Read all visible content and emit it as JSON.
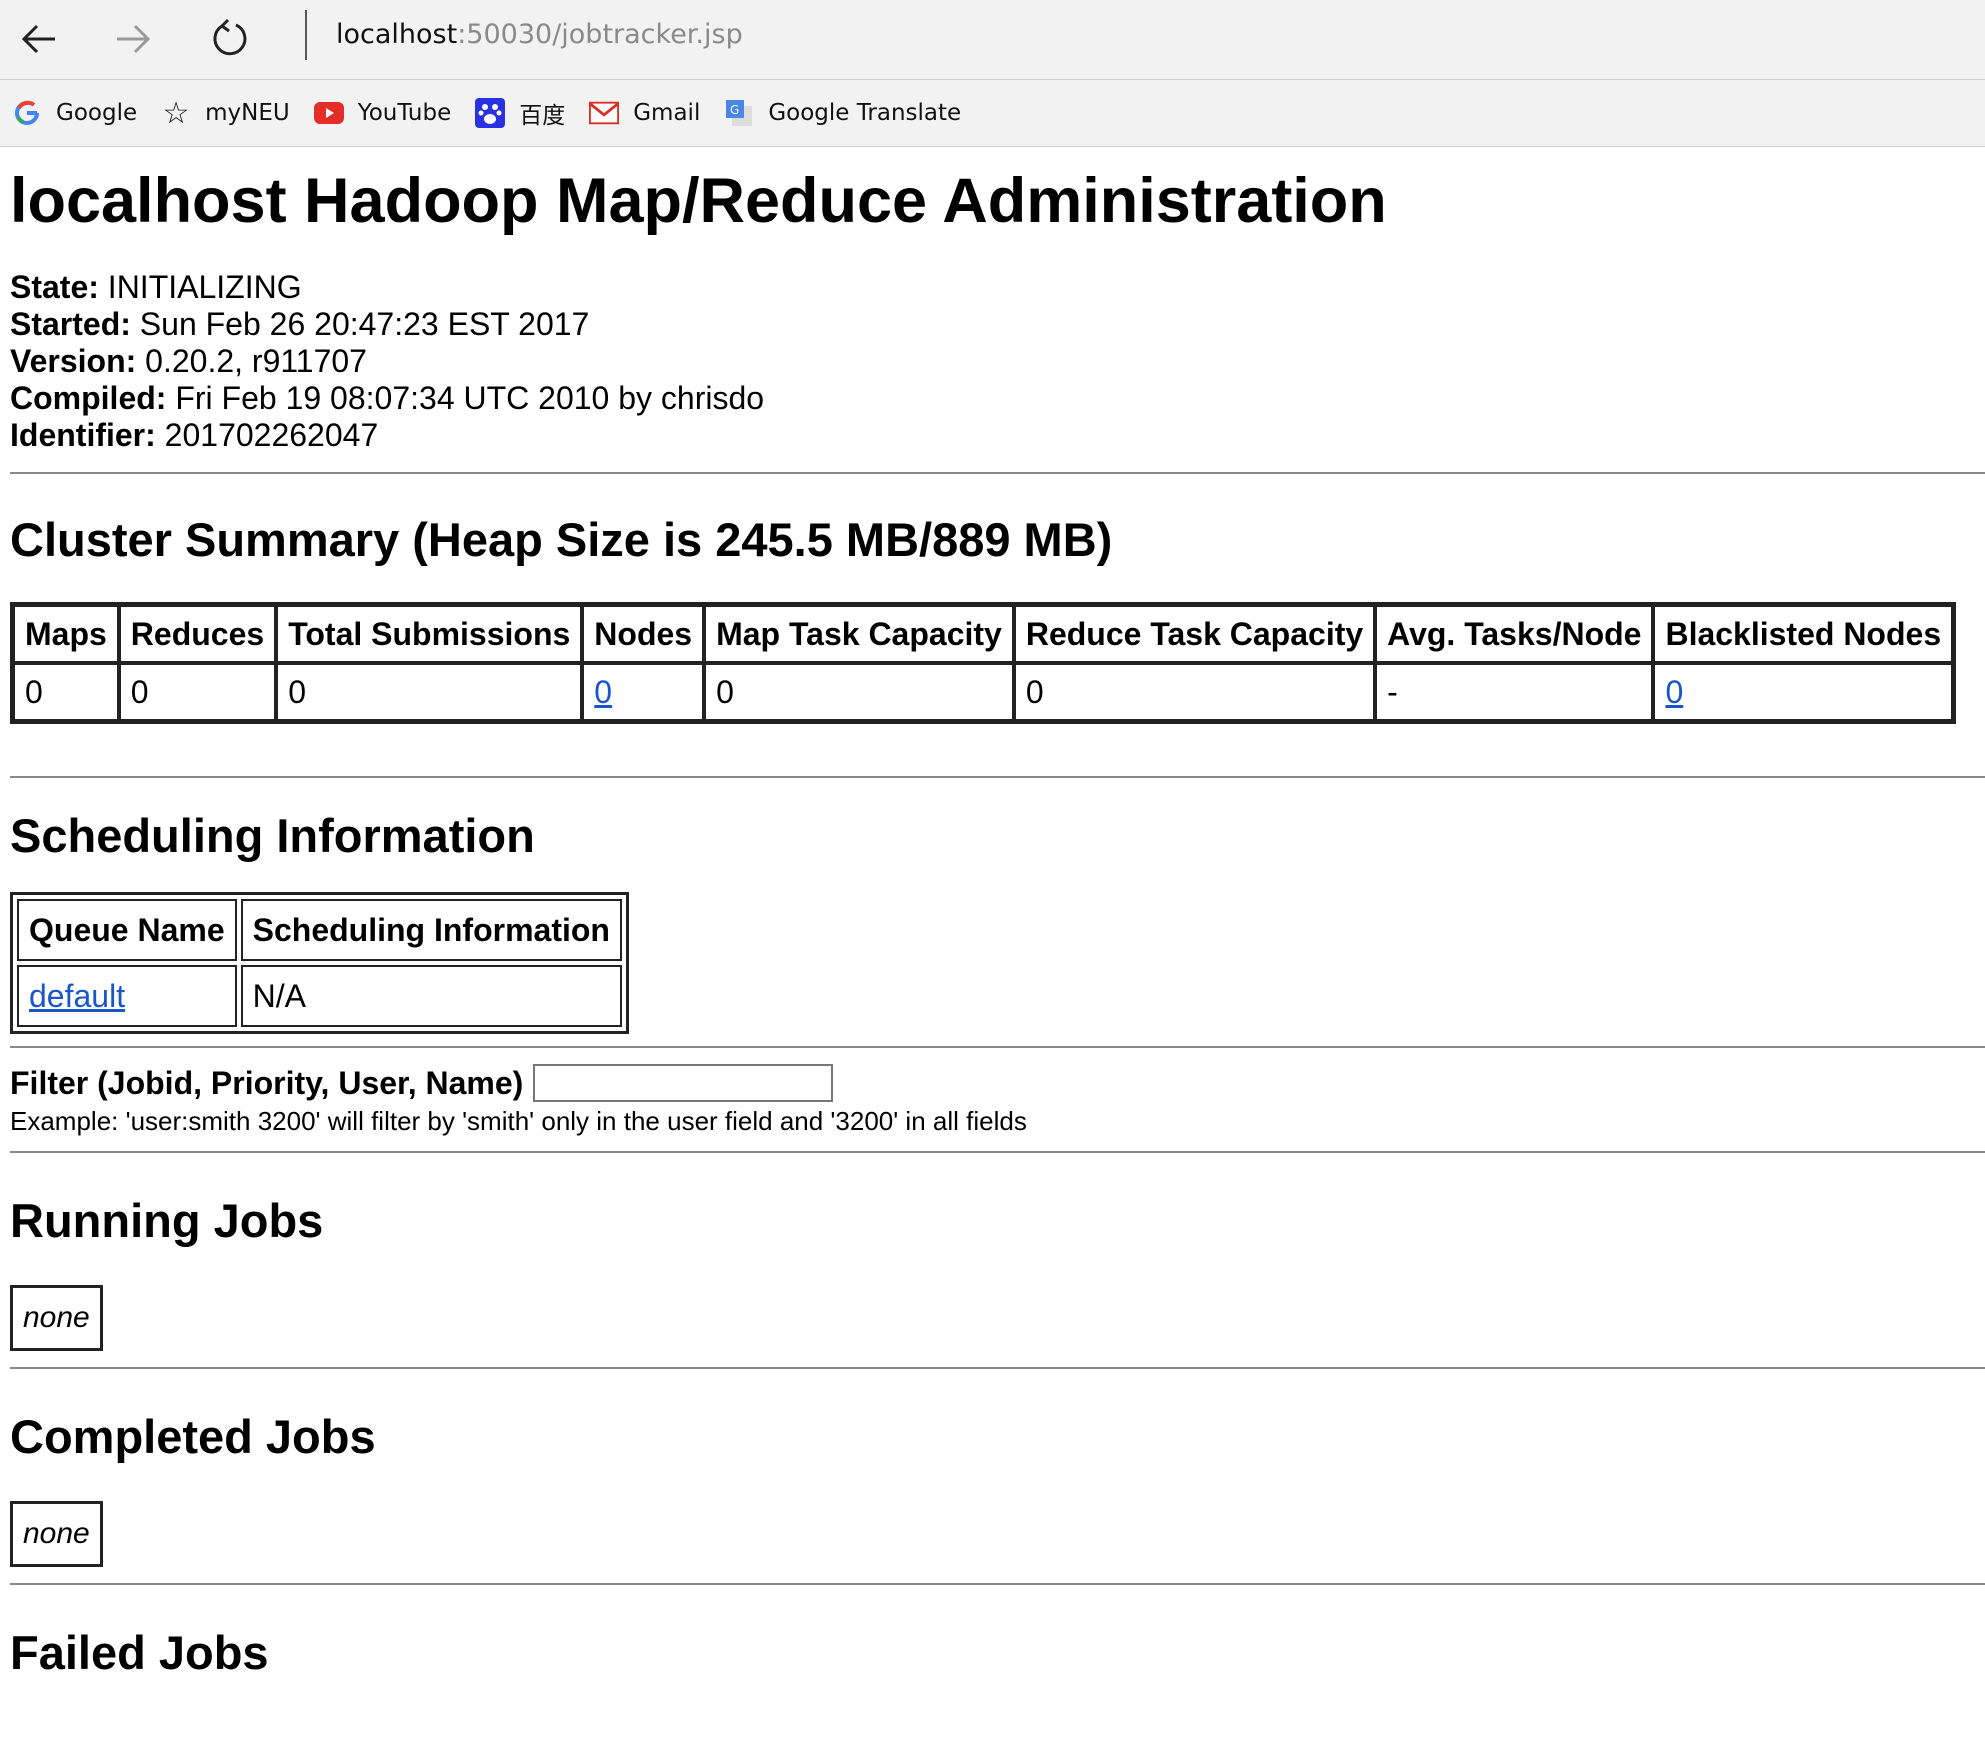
{
  "browser": {
    "address_host": "localhost",
    "address_path": ":50030/jobtracker.jsp",
    "favorites": [
      {
        "label": "Google",
        "icon": "google-icon"
      },
      {
        "label": "myNEU",
        "icon": "star-icon"
      },
      {
        "label": "YouTube",
        "icon": "youtube-icon"
      },
      {
        "label": "百度",
        "icon": "baidu-icon"
      },
      {
        "label": "Gmail",
        "icon": "gmail-icon"
      },
      {
        "label": "Google Translate",
        "icon": "google-translate-icon"
      }
    ]
  },
  "page": {
    "title": "localhost Hadoop Map/Reduce Administration",
    "info": [
      {
        "key": "State:",
        "value": " INITIALIZING"
      },
      {
        "key": "Started:",
        "value": " Sun Feb 26 20:47:23 EST 2017"
      },
      {
        "key": "Version:",
        "value": " 0.20.2, r911707"
      },
      {
        "key": "Compiled:",
        "value": " Fri Feb 19 08:07:34 UTC 2010 by chrisdo"
      },
      {
        "key": "Identifier:",
        "value": " 201702262047"
      }
    ],
    "cluster_summary": {
      "heading": "Cluster Summary (Heap Size is 245.5 MB/889 MB)",
      "headers": [
        "Maps",
        "Reduces",
        "Total Submissions",
        "Nodes",
        "Map Task Capacity",
        "Reduce Task Capacity",
        "Avg. Tasks/Node",
        "Blacklisted Nodes"
      ],
      "values": [
        "0",
        "0",
        "0",
        "0",
        "0",
        "0",
        "-",
        "0"
      ]
    },
    "scheduling": {
      "heading": "Scheduling Information",
      "headers": [
        "Queue Name",
        "Scheduling Information"
      ],
      "row": [
        "default",
        "N/A"
      ]
    },
    "filter": {
      "label": "Filter (Jobid, Priority, User, Name)",
      "value": "",
      "example": "Example: 'user:smith 3200' will filter by 'smith' only in the user field and '3200' in all fields"
    },
    "running_jobs": {
      "heading": "Running Jobs",
      "content": "none"
    },
    "completed_jobs": {
      "heading": "Completed Jobs",
      "content": "none"
    },
    "failed_jobs": {
      "heading": "Failed Jobs"
    }
  },
  "colors": {
    "link": "#1a56c9",
    "chrome_bg": "#f2f2f2"
  }
}
